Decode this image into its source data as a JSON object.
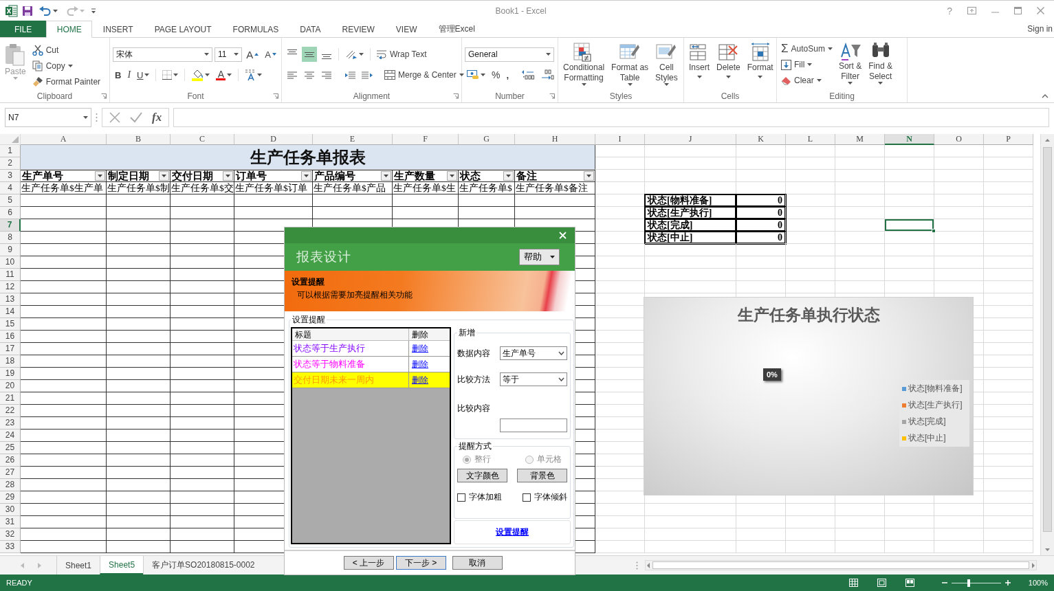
{
  "window": {
    "title": "Book1 - Excel",
    "help": "?"
  },
  "ribbon_tabs": [
    {
      "label": "FILE",
      "kind": "file",
      "selected": false
    },
    {
      "label": "HOME",
      "kind": "tab",
      "selected": true
    },
    {
      "label": "INSERT",
      "kind": "tab",
      "selected": false
    },
    {
      "label": "PAGE LAYOUT",
      "kind": "tab",
      "selected": false
    },
    {
      "label": "FORMULAS",
      "kind": "tab",
      "selected": false
    },
    {
      "label": "DATA",
      "kind": "tab",
      "selected": false
    },
    {
      "label": "REVIEW",
      "kind": "tab",
      "selected": false
    },
    {
      "label": "VIEW",
      "kind": "tab",
      "selected": false
    },
    {
      "label": "管理Excel",
      "kind": "tab",
      "selected": false
    }
  ],
  "account": {
    "sign_in": "Sign in"
  },
  "ribbon": {
    "clipboard": {
      "label": "Clipboard",
      "paste": "Paste",
      "cut": "Cut",
      "copy": "Copy",
      "format_painter": "Format Painter"
    },
    "font": {
      "label": "Font",
      "font_name": "宋体",
      "font_size": "11",
      "grow_font": "A",
      "shrink_font": "A",
      "bold": "B",
      "italic": "I",
      "underline": "U",
      "font_color": "A"
    },
    "alignment": {
      "label": "Alignment",
      "vertical_align": [
        {
          "selected": false
        },
        {
          "selected": true
        },
        {
          "selected": false
        }
      ],
      "wrap_text": "Wrap Text",
      "merge_center": "Merge & Center"
    },
    "number": {
      "label": "Number",
      "format": "General",
      "percent": "%",
      "comma": ","
    },
    "styles": {
      "label": "Styles",
      "buttons": [
        "Conditional\nFormatting",
        "Format as\nTable",
        "Cell\nStyles"
      ]
    },
    "cells": {
      "label": "Cells",
      "buttons": [
        "Insert",
        "Delete",
        "Format"
      ]
    },
    "editing": {
      "label": "Editing",
      "autosum_symbol": "Σ",
      "autosum": "AutoSum",
      "fill": "Fill",
      "clear": "Clear",
      "buttons": [
        "Sort &\nFilter",
        "Find &\nSelect"
      ]
    }
  },
  "formula_bar": {
    "name_box": "N7",
    "function_symbol": "fx"
  },
  "sheet": {
    "columns": [
      {
        "label": "A",
        "selected": false
      },
      {
        "label": "B",
        "selected": false
      },
      {
        "label": "C",
        "selected": false
      },
      {
        "label": "D",
        "selected": false
      },
      {
        "label": "E",
        "selected": false
      },
      {
        "label": "F",
        "selected": false
      },
      {
        "label": "G",
        "selected": false
      },
      {
        "label": "H",
        "selected": false
      },
      {
        "label": "I",
        "selected": false
      },
      {
        "label": "J",
        "selected": false
      },
      {
        "label": "K",
        "selected": false
      },
      {
        "label": "L",
        "selected": false
      },
      {
        "label": "M",
        "selected": false
      },
      {
        "label": "N",
        "selected": true
      },
      {
        "label": "O",
        "selected": false
      },
      {
        "label": "P",
        "selected": false
      }
    ],
    "rows": [
      {
        "label": "1",
        "selected": false
      },
      {
        "label": "2",
        "selected": false
      },
      {
        "label": "3",
        "selected": false
      },
      {
        "label": "4",
        "selected": false
      },
      {
        "label": "5",
        "selected": false
      },
      {
        "label": "6",
        "selected": false
      },
      {
        "label": "7",
        "selected": true
      },
      {
        "label": "8",
        "selected": false
      },
      {
        "label": "9",
        "selected": false
      },
      {
        "label": "10",
        "selected": false
      },
      {
        "label": "11",
        "selected": false
      },
      {
        "label": "12",
        "selected": false
      },
      {
        "label": "13",
        "selected": false
      },
      {
        "label": "14",
        "selected": false
      },
      {
        "label": "15",
        "selected": false
      },
      {
        "label": "16",
        "selected": false
      },
      {
        "label": "17",
        "selected": false
      },
      {
        "label": "18",
        "selected": false
      },
      {
        "label": "19",
        "selected": false
      },
      {
        "label": "20",
        "selected": false
      },
      {
        "label": "21",
        "selected": false
      },
      {
        "label": "22",
        "selected": false
      },
      {
        "label": "23",
        "selected": false
      },
      {
        "label": "24",
        "selected": false
      },
      {
        "label": "25",
        "selected": false
      },
      {
        "label": "26",
        "selected": false
      },
      {
        "label": "27",
        "selected": false
      },
      {
        "label": "28",
        "selected": false
      },
      {
        "label": "29",
        "selected": false
      },
      {
        "label": "30",
        "selected": false
      },
      {
        "label": "31",
        "selected": false
      },
      {
        "label": "32",
        "selected": false
      },
      {
        "label": "33",
        "selected": false
      }
    ],
    "title": "生产任务单报表",
    "headers": [
      "生产单号",
      "制定日期",
      "交付日期",
      "订单号",
      "产品编号",
      "生产数量",
      "状态",
      "备注"
    ],
    "fields": [
      "生产任务单$生产单",
      "生产任务单$制",
      "生产任务单$交",
      "生产任务单$订单",
      "生产任务单$产品",
      "生产任务单$生",
      "生产任务单$",
      "生产任务单$备注"
    ],
    "summary": [
      {
        "label": "状态[物料准备]",
        "value": "0"
      },
      {
        "label": "状态[生产执行]",
        "value": "0"
      },
      {
        "label": "状态[完成]",
        "value": "0"
      },
      {
        "label": "状态[中止]",
        "value": "0"
      }
    ]
  },
  "chart": {
    "title": "生产任务单执行状态",
    "data_label": "0%",
    "legend": [
      {
        "label": "状态[物料准备]",
        "color": "#5b9bd5"
      },
      {
        "label": "状态[生产执行]",
        "color": "#ed7d31"
      },
      {
        "label": "状态[完成]",
        "color": "#a5a5a5"
      },
      {
        "label": "状态[中止]",
        "color": "#ffc000"
      }
    ]
  },
  "dialog": {
    "title": "报表设计",
    "help": "帮助",
    "banner_title": "设置提醒",
    "banner_text": "可以根据需要加亮提醒相关功能",
    "group_title": "设置提醒",
    "list_columns": [
      "标题",
      "删除"
    ],
    "reminders": [
      {
        "title": "状态等于生产执行",
        "action": "删除",
        "color": "#8000ff",
        "highlighted": false
      },
      {
        "title": "状态等于物料准备",
        "action": "删除",
        "color": "#ff00ff",
        "highlighted": false
      },
      {
        "title": "交付日期未来一周内",
        "action": "删除",
        "color": "#ff9900",
        "highlighted": true
      }
    ],
    "new_group": "新增",
    "data_label": "数据内容",
    "data_value": "生产单号",
    "method_label": "比较方法",
    "method_value": "等于",
    "content_label": "比较内容",
    "mode_group": "提醒方式",
    "mode_disabled": true,
    "modes": [
      {
        "label": "整行",
        "selected": true
      },
      {
        "label": "单元格",
        "selected": false
      }
    ],
    "color_buttons": [
      "文字颜色",
      "背景色"
    ],
    "styles": [
      {
        "label": "字体加粗",
        "checked": false
      },
      {
        "label": "字体倾斜",
        "checked": false
      }
    ],
    "apply_link": "设置提醒",
    "buttons": [
      {
        "label": "< 上一步",
        "focused": false
      },
      {
        "label": "下一步 >",
        "focused": true
      },
      {
        "label": "取消",
        "focused": false
      }
    ]
  },
  "sheet_tabs": [
    {
      "label": "Sheet1",
      "selected": false
    },
    {
      "label": "Sheet5",
      "selected": true
    },
    {
      "label": "客户订单SO20180815-0002",
      "selected": false
    }
  ],
  "status_bar": {
    "status": "READY",
    "zoom_slider": {
      "level": 0.35
    },
    "zoom": "100%"
  }
}
